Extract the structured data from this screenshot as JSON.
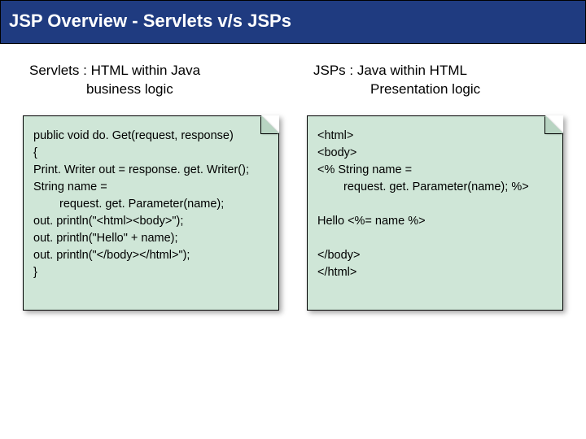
{
  "title": "JSP Overview - Servlets v/s JSPs",
  "left": {
    "header_line1": "Servlets : HTML within Java",
    "header_line2": "business logic",
    "code": {
      "l1": "public void do. Get(request, response)",
      "l2": "{",
      "l3": "Print. Writer out = response. get. Writer();",
      "l4": "String name =",
      "l5": "request. get. Parameter(name);",
      "l6": "out. println(\"<html><body>\");",
      "l7": "out. println(\"Hello\" + name);",
      "l8": "out. println(\"</body></html>\");",
      "l9": "}"
    }
  },
  "right": {
    "header_line1": "JSPs : Java within HTML",
    "header_line2": "Presentation logic",
    "code": {
      "l1": "<html>",
      "l2": "<body>",
      "l3": "<% String name =",
      "l4": "request. get. Parameter(name); %>",
      "l5": "Hello <%= name %>",
      "l6": "</body>",
      "l7": "</html>"
    }
  }
}
